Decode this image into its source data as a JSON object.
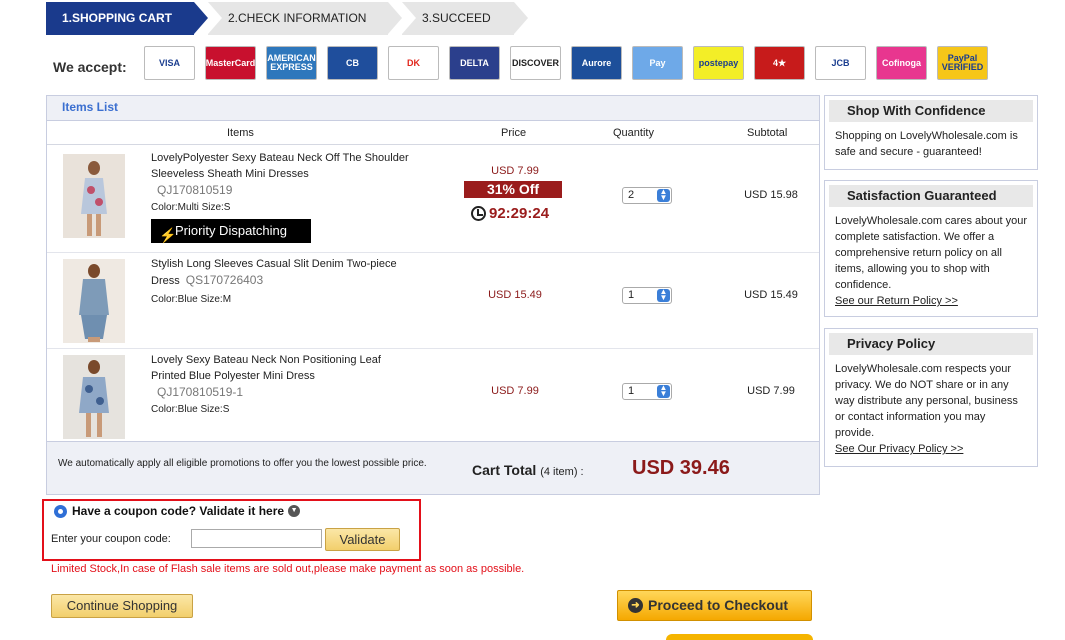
{
  "steps": [
    {
      "label": "1.SHOPPING CART"
    },
    {
      "label": "2.CHECK INFORMATION"
    },
    {
      "label": "3.SUCCEED"
    }
  ],
  "payment": {
    "label": "We accept:",
    "logos": [
      {
        "name": "visa-logo",
        "text": "VISA",
        "bg": "#ffffff",
        "fg": "#1a3d8f"
      },
      {
        "name": "mastercard-logo",
        "text": "MasterCard",
        "bg": "#c8102e",
        "fg": "#ffffff"
      },
      {
        "name": "amex-logo",
        "text": "AMERICAN EXPRESS",
        "bg": "#2e77bc",
        "fg": "#ffffff"
      },
      {
        "name": "cb-logo",
        "text": "CB",
        "bg": "#1f4e9c",
        "fg": "#ffffff"
      },
      {
        "name": "dankort-logo",
        "text": "DK",
        "bg": "#ffffff",
        "fg": "#e1251b"
      },
      {
        "name": "delta-logo",
        "text": "DELTA",
        "bg": "#2b3f8c",
        "fg": "#ffffff"
      },
      {
        "name": "discover-logo",
        "text": "DISCOVER",
        "bg": "#ffffff",
        "fg": "#222222"
      },
      {
        "name": "aurore-logo",
        "text": "Aurore",
        "bg": "#1d4f9a",
        "fg": "#ffffff"
      },
      {
        "name": "paysafe-logo",
        "text": "Pay",
        "bg": "#6ea9e8",
        "fg": "#ffffff"
      },
      {
        "name": "postepay-logo",
        "text": "postepay",
        "bg": "#f3ee27",
        "fg": "#1a3d8f"
      },
      {
        "name": "4etoiles-logo",
        "text": "4★",
        "bg": "#c71b1b",
        "fg": "#ffffff"
      },
      {
        "name": "jcb-logo",
        "text": "JCB",
        "bg": "#ffffff",
        "fg": "#1a3d8f"
      },
      {
        "name": "cofinoga-logo",
        "text": "Cofinoga",
        "bg": "#e8368f",
        "fg": "#ffffff"
      },
      {
        "name": "paypal-verified-logo",
        "text": "PayPal VERIFIED",
        "bg": "#f6c619",
        "fg": "#1a3d8f"
      }
    ]
  },
  "items_list": {
    "title": "Items List",
    "headers": {
      "items": "Items",
      "price": "Price",
      "quantity": "Quantity",
      "subtotal": "Subtotal"
    },
    "rows": [
      {
        "name": "LovelyPolyester Sexy Bateau Neck Off The Shoulder Sleeveless Sheath Mini Dresses",
        "sku": "QJ170810519",
        "attrs": "Color:Multi Size:S",
        "price": "USD 7.99",
        "discount": "31% Off",
        "timer": "92:29:24",
        "priority": "Priority Dispatching",
        "quantity": "2",
        "subtotal": "USD 15.98"
      },
      {
        "name": "Stylish Long Sleeves Casual Slit Denim Two-piece Dress",
        "sku": "QS170726403",
        "attrs": "Color:Blue Size:M",
        "price": "USD 15.49",
        "quantity": "1",
        "subtotal": "USD 15.49"
      },
      {
        "name": "Lovely Sexy Bateau Neck Non Positioning Leaf Printed Blue Polyester Mini Dress",
        "sku": "QJ170810519-1",
        "attrs": "Color:Blue Size:S",
        "price": "USD 7.99",
        "quantity": "1",
        "subtotal": "USD 7.99"
      }
    ],
    "promo_note": "We automatically apply all eligible promotions to offer you the lowest possible price.",
    "cart_total_label": "Cart Total",
    "cart_total_count": "(4 item) :",
    "cart_total_amount": "USD 39.46"
  },
  "panels": {
    "confidence": {
      "title": "Shop With Confidence",
      "body": "Shopping on LovelyWholesale.com is safe and secure - guaranteed!"
    },
    "satisfaction": {
      "title": "Satisfaction Guaranteed",
      "body": "LovelyWholesale.com cares about your complete satisfaction. We offer a comprehensive return policy on all items, allowing you to shop with confidence.",
      "link": "See our Return Policy >>"
    },
    "privacy": {
      "title": "Privacy Policy",
      "body": "LovelyWholesale.com respects your privacy. We do NOT share or in any way distribute any personal, business or contact information you may provide.",
      "link": "See Our Privacy Policy >>"
    }
  },
  "coupon": {
    "heading": "Have a coupon code? Validate it here",
    "label": "Enter your coupon code:",
    "value": "",
    "button": "Validate"
  },
  "notice": "Limited Stock,In case of Flash sale items are sold out,please make payment as soon as possible.",
  "actions": {
    "continue": "Continue Shopping",
    "checkout": "Proceed to Checkout"
  }
}
